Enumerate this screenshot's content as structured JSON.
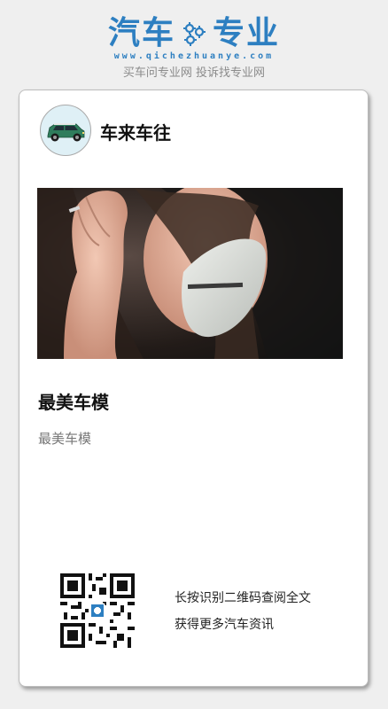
{
  "header": {
    "logo_left": "汽车",
    "logo_right": "专业",
    "url": "www.qichezhuanye.com",
    "slogan": "买车问专业网 投诉找专业网"
  },
  "card": {
    "author": "车来车往",
    "title": "最美车模",
    "description": "最美车模",
    "qr_line1": "长按识别二维码查阅全文",
    "qr_line2": "获得更多汽车资讯"
  },
  "colors": {
    "brand_blue": "#2d7fc1",
    "page_bg": "#efefef",
    "card_bg": "#ffffff",
    "muted_text": "#777777"
  },
  "icons": {
    "logo_gear": "gear-icon",
    "avatar": "car-icon"
  }
}
